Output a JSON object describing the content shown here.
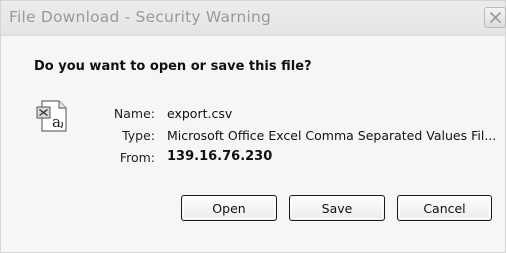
{
  "window": {
    "title": "File Download - Security Warning"
  },
  "question": "Do you want to open or save this file?",
  "file": {
    "icon": "excel-csv-file-icon",
    "name_label": "Name:",
    "name_value": "export.csv",
    "type_label": "Type:",
    "type_value": "Microsoft Office Excel Comma Separated Values Fil...",
    "from_label": "From:",
    "from_value": "139.16.76.230"
  },
  "buttons": {
    "open": "Open",
    "save": "Save",
    "cancel": "Cancel"
  },
  "colors": {
    "title_text": "#9a9a9a",
    "background": "#f6f6f6",
    "button_border": "#1b1b1b"
  }
}
